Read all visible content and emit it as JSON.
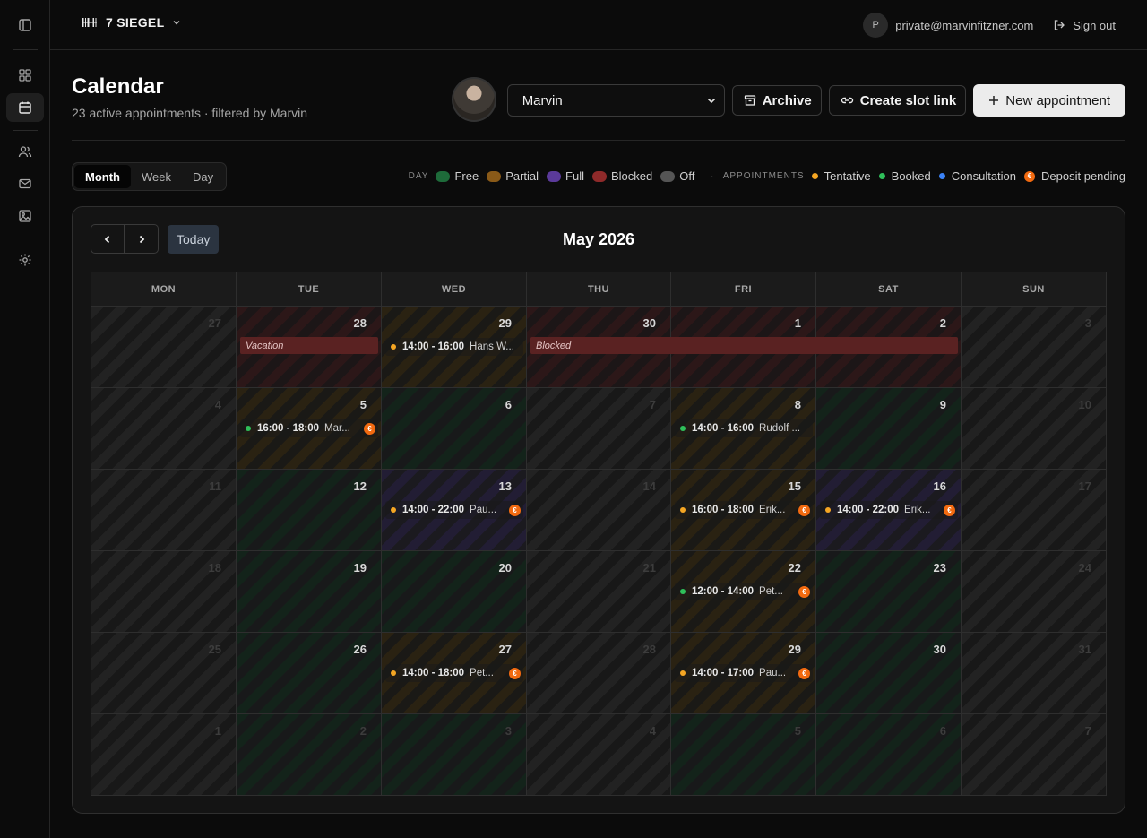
{
  "app": {
    "brand": "7 SIEGEL",
    "user_initial": "P",
    "user_email": "private@marvinfitzner.com",
    "signout_label": "Sign out"
  },
  "sidebar": {
    "items": [
      {
        "name": "toggle-sidebar-icon"
      },
      {
        "name": "dashboard-icon"
      },
      {
        "name": "calendar-icon",
        "active": true
      },
      {
        "name": "users-icon"
      },
      {
        "name": "mail-icon"
      },
      {
        "name": "image-icon"
      },
      {
        "name": "settings-icon"
      }
    ]
  },
  "header": {
    "title": "Calendar",
    "subtitle": "23 active appointments · filtered by Marvin",
    "artist_select": "Marvin",
    "archive_label": "Archive",
    "slot_link_label": "Create slot link",
    "new_appt_label": "New appointment"
  },
  "view_tabs": [
    "Month",
    "Week",
    "Day"
  ],
  "active_view": "Month",
  "legend": {
    "day_heading": "DAY",
    "day": [
      {
        "label": "Free",
        "color": "#1e6b3a"
      },
      {
        "label": "Partial",
        "color": "#8a5a18"
      },
      {
        "label": "Full",
        "color": "#5b3a9a"
      },
      {
        "label": "Blocked",
        "color": "#8f2a2a"
      },
      {
        "label": "Off",
        "color": "#555555"
      }
    ],
    "appt_heading": "APPOINTMENTS",
    "appointments": [
      {
        "label": "Tentative",
        "color": "#f5a623"
      },
      {
        "label": "Booked",
        "color": "#2fbf5a"
      },
      {
        "label": "Consultation",
        "color": "#3b82f6"
      },
      {
        "label": "Deposit pending",
        "icon": "€"
      }
    ]
  },
  "calendar": {
    "month_label": "May 2026",
    "today_label": "Today",
    "weekdays": [
      "MON",
      "TUE",
      "WED",
      "THU",
      "FRI",
      "SAT",
      "SUN"
    ],
    "weeks": [
      [
        {
          "d": "27",
          "out": true,
          "s": "off"
        },
        {
          "d": "28",
          "s": "blocked"
        },
        {
          "d": "29",
          "s": "partial"
        },
        {
          "d": "30",
          "s": "blocked"
        },
        {
          "d": "1",
          "s": "blocked"
        },
        {
          "d": "2",
          "s": "blocked"
        },
        {
          "d": "3",
          "out": true,
          "s": "off"
        }
      ],
      [
        {
          "d": "4",
          "out": true,
          "s": "off"
        },
        {
          "d": "5",
          "s": "partial"
        },
        {
          "d": "6",
          "s": "free"
        },
        {
          "d": "7",
          "out": true,
          "s": "off"
        },
        {
          "d": "8",
          "s": "partial"
        },
        {
          "d": "9",
          "s": "free"
        },
        {
          "d": "10",
          "out": true,
          "s": "off"
        }
      ],
      [
        {
          "d": "11",
          "out": true,
          "s": "off"
        },
        {
          "d": "12",
          "s": "free"
        },
        {
          "d": "13",
          "s": "full"
        },
        {
          "d": "14",
          "out": true,
          "s": "off"
        },
        {
          "d": "15",
          "s": "partial"
        },
        {
          "d": "16",
          "s": "full"
        },
        {
          "d": "17",
          "out": true,
          "s": "off"
        }
      ],
      [
        {
          "d": "18",
          "out": true,
          "s": "off"
        },
        {
          "d": "19",
          "s": "free"
        },
        {
          "d": "20",
          "s": "free"
        },
        {
          "d": "21",
          "out": true,
          "s": "off"
        },
        {
          "d": "22",
          "s": "partial"
        },
        {
          "d": "23",
          "s": "free"
        },
        {
          "d": "24",
          "out": true,
          "s": "off"
        }
      ],
      [
        {
          "d": "25",
          "out": true,
          "s": "off"
        },
        {
          "d": "26",
          "s": "free"
        },
        {
          "d": "27",
          "s": "partial"
        },
        {
          "d": "28",
          "out": true,
          "s": "off"
        },
        {
          "d": "29",
          "s": "partial"
        },
        {
          "d": "30",
          "s": "free"
        },
        {
          "d": "31",
          "out": true,
          "s": "off"
        }
      ],
      [
        {
          "d": "1",
          "out": true,
          "s": "off"
        },
        {
          "d": "2",
          "out": true,
          "s": "free"
        },
        {
          "d": "3",
          "out": true,
          "s": "free"
        },
        {
          "d": "4",
          "out": true,
          "s": "off"
        },
        {
          "d": "5",
          "out": true,
          "s": "free"
        },
        {
          "d": "6",
          "out": true,
          "s": "free"
        },
        {
          "d": "7",
          "out": true,
          "s": "off"
        }
      ]
    ],
    "bars": [
      {
        "week": 0,
        "col": 1,
        "span": 1,
        "label": "Vacation"
      },
      {
        "week": 0,
        "col": 3,
        "span": 3,
        "label": "Blocked"
      }
    ],
    "appointments": [
      {
        "week": 0,
        "col": 2,
        "time": "14:00 - 16:00",
        "name": "Hans W...",
        "status": "tentative",
        "deposit": false
      },
      {
        "week": 1,
        "col": 1,
        "time": "16:00 - 18:00",
        "name": "Mar...",
        "status": "booked",
        "deposit": true
      },
      {
        "week": 1,
        "col": 4,
        "time": "14:00 - 16:00",
        "name": "Rudolf ...",
        "status": "booked",
        "deposit": false
      },
      {
        "week": 2,
        "col": 2,
        "time": "14:00 - 22:00",
        "name": "Pau...",
        "status": "tentative",
        "deposit": true
      },
      {
        "week": 2,
        "col": 4,
        "time": "16:00 - 18:00",
        "name": "Erik...",
        "status": "tentative",
        "deposit": true
      },
      {
        "week": 2,
        "col": 5,
        "time": "14:00 - 22:00",
        "name": "Erik...",
        "status": "tentative",
        "deposit": true
      },
      {
        "week": 3,
        "col": 4,
        "time": "12:00 - 14:00",
        "name": "Pet...",
        "status": "booked",
        "deposit": true
      },
      {
        "week": 4,
        "col": 2,
        "time": "14:00 - 18:00",
        "name": "Pet...",
        "status": "tentative",
        "deposit": true
      },
      {
        "week": 4,
        "col": 4,
        "time": "14:00 - 17:00",
        "name": "Pau...",
        "status": "tentative",
        "deposit": true
      }
    ]
  }
}
